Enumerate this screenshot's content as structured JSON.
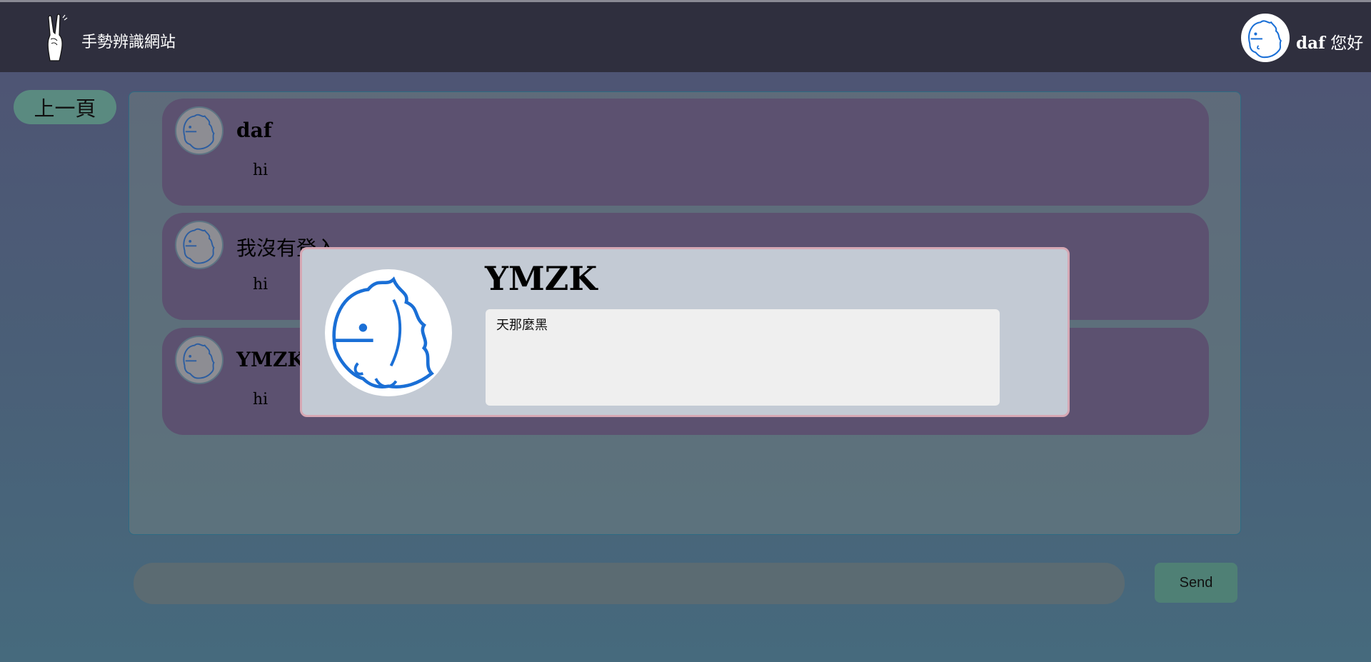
{
  "header": {
    "site_title": "手勢辨識網站",
    "user_name": "daf",
    "greeting_suffix": "您好"
  },
  "nav": {
    "back_label": "上一頁"
  },
  "messages": [
    {
      "name": "daf",
      "text": "hi"
    },
    {
      "name": "我沒有登入",
      "text": "hi"
    },
    {
      "name": "YMZK",
      "text": "hi"
    }
  ],
  "composer": {
    "input_value": "",
    "send_label": "Send"
  },
  "profile_modal": {
    "name": "YMZK",
    "bio": "天那麼黑"
  },
  "colors": {
    "header_bg": "#2f2f3e",
    "message_bg": "#5c5170",
    "accent_button": "#5a8a80",
    "modal_bg": "#c3cad4",
    "modal_border": "#d6a8b4"
  },
  "icons": {
    "logo": "rock-hand-icon",
    "avatar": "dinosaur-avatar-icon"
  }
}
